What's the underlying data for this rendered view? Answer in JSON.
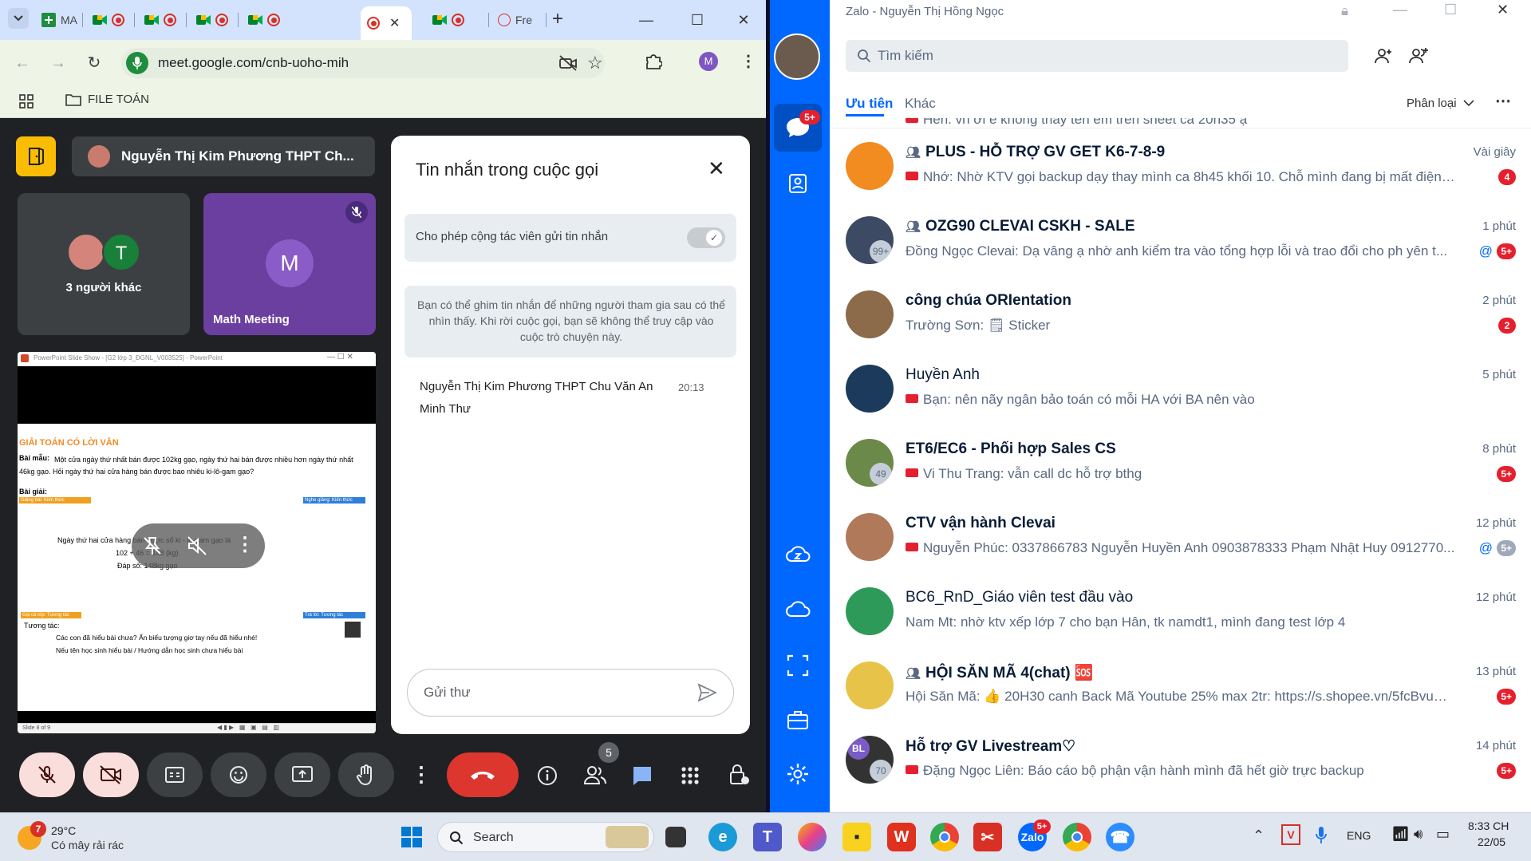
{
  "chrome": {
    "tabs": [
      {
        "label": "MA"
      },
      {
        "label": ""
      },
      {
        "label": ""
      },
      {
        "label": ""
      },
      {
        "label": ""
      },
      {
        "label": ""
      },
      {
        "label": ""
      },
      {
        "label": "Fre"
      }
    ],
    "url": "meet.google.com/cnb-uoho-mih",
    "profile_initial": "M",
    "bookmark_folder": "FILE TOÁN"
  },
  "meet": {
    "presenter_chip": "Nguyễn Thị Kim Phương THPT Ch...",
    "others_tile": {
      "label": "3 người khác",
      "avatar_initial": "T"
    },
    "math_tile": {
      "label": "Math Meeting",
      "avatar_initial": "M"
    },
    "slide": {
      "window_title": "PowerPoint Slide Show - [G2 lớp 3_ĐGNL_V003525] - PowerPoint",
      "heading": "GIẢI TOÁN CÓ LỜI VĂN",
      "problem_label": "Bài mẫu:",
      "problem_text": "Một cửa ngày thứ nhất bán được 102kg gạo, ngày thứ hai bán được nhiều hơn ngày thứ nhất 46kg gạo. Hỏi ngày thứ hai cửa hàng bán được bao nhiêu ki-lô-gam gạo?",
      "solution_label": "Bài giải:",
      "tag_left": "Giảng bài: Kiến thức",
      "tag_right": "Nghe giảng: Kiến thức",
      "line1": "Ngày thứ hai cửa hàng bán được số ki - lô-gam gạo là",
      "line2": "102 + 46 = 148 (kg)",
      "line3": "Đáp số: 148kg gạo",
      "tag_left2": "Gọi cá lớp: Tương tác",
      "tag_right2": "Trả lời: Tương tác",
      "interact_label": "Tương tác:",
      "interact1": "Các con đã hiểu bài chưa? Ấn biểu tượng giơ tay nếu đã hiểu nhé!",
      "interact2": "Nếu tên học sinh hiểu bài / Hướng dẫn học sinh chưa hiểu bài",
      "status": "Slide 8 of 9"
    },
    "participants_count": "5"
  },
  "chat": {
    "title": "Tin nhắn trong cuộc gọi",
    "toggle_label": "Cho phép cộng tác viên gửi tin nhắn",
    "info_text": "Bạn có thể ghim tin nhắn để những người tham gia sau có thể nhìn thấy. Khi rời cuộc gọi, bạn sẽ không thể truy cập vào cuộc trò chuyện này.",
    "message": {
      "sender": "Nguyễn Thị Kim Phương THPT Chu Văn An",
      "time": "20:13",
      "text": "Minh Thư"
    },
    "input_placeholder": "Gửi thư"
  },
  "zalo": {
    "window_title": "Zalo - Nguyễn Thị Hồng Ngọc",
    "search_placeholder": "Tìm kiếm",
    "tabs": {
      "priority": "Ưu tiên",
      "other": "Khác",
      "classify": "Phân loại"
    },
    "chat_badge": "5+",
    "partial_preview": "Hen. vh ơi e không thay tên em trên sheet ca 20h35 ạ",
    "conversations": [
      {
        "name": "PLUS - HỖ TRỢ GV GET K6-7-8-9",
        "preview": "Nhớ: Nhờ KTV gọi backup dạy thay mình ca 8h45 khối 10. Chỗ mình đang bị mất điện ạ. ...",
        "time": "Vài giây",
        "badge": "4",
        "group": true,
        "bold": true,
        "flag": true
      },
      {
        "name": "OZG90 CLEVAI CSKH - SALE",
        "preview": "Đồng Ngọc Clevai: Dạ vâng ạ nhờ anh kiểm tra vào tổng hợp lỗi và trao đổi cho ph yên t...",
        "time": "1 phút",
        "badge": "5+",
        "group": true,
        "bold": true,
        "mention": true,
        "count": "99+"
      },
      {
        "name": "công chúa ORIentation",
        "preview": "Trường Sơn: 🗒 Sticker",
        "time": "2 phút",
        "badge": "2",
        "bold": true
      },
      {
        "name": "Huyền Anh",
        "preview": "Bạn: nên nãy ngân bảo toán có mỗi HA với BA nên vào",
        "time": "5 phút",
        "flag": true
      },
      {
        "name": "ET6/EC6 - Phối hợp Sales  CS",
        "preview": "Vi Thu Trang: vẫn call dc hỗ trợ bthg",
        "time": "8 phút",
        "badge": "5+",
        "bold": true,
        "flag": true,
        "count": "49"
      },
      {
        "name": "CTV vận hành Clevai",
        "preview": "Nguyễn Phúc: 0337866783 Nguyễn Huyền Anh 0903878333 Phạm Nhật Huy 0912770...",
        "time": "12 phút",
        "badge": "5+",
        "badge_gray": true,
        "bold": true,
        "flag": true,
        "mention": true
      },
      {
        "name": "BC6_RnD_Giáo viên test đầu vào",
        "preview": "Nam Mt: nhờ ktv xếp lớp 7 cho bạn Hân, tk namdt1, mình đang test lớp 4",
        "time": "12 phút"
      },
      {
        "name": "HỘI SĂN MÃ 4(chat) 🆘",
        "preview": "Hội Săn Mã: 👍 20H30 canh Back Mã Youtube 25% max 2tr: https://s.shopee.vn/5fcBvuE90j ...",
        "time": "13 phút",
        "badge": "5+",
        "group": true,
        "bold": true
      },
      {
        "name": "Hỗ trợ GV Livestream♡",
        "preview": "Đặng Ngọc Liên: Báo cáo bộ phận vận hành mình đã hết giờ trực backup",
        "time": "14 phút",
        "badge": "5+",
        "bold": true,
        "flag": true,
        "count": "70",
        "avatar_initials": "BL"
      }
    ]
  },
  "taskbar": {
    "weather_temp": "29°C",
    "weather_desc": "Có mây rải rác",
    "weather_badge": "7",
    "search_label": "Search",
    "lang": "ENG",
    "time": "8:33 CH",
    "date": "22/05",
    "zalo_badge": "5+"
  }
}
